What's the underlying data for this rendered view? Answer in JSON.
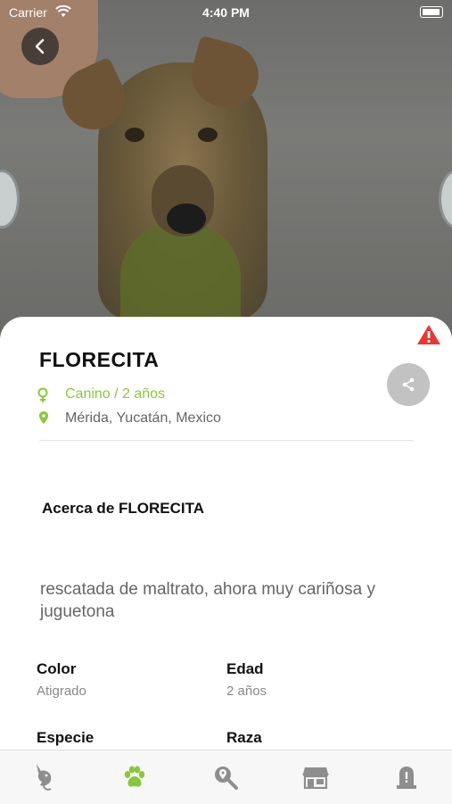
{
  "status_bar": {
    "carrier": "Carrier",
    "time": "4:40 PM"
  },
  "pet": {
    "name": "FLORECITA",
    "species_age": "Canino / 2 años",
    "location": "Mérida, Yucatán, Mexico",
    "about_title": "Acerca de FLORECITA",
    "description": "rescatada de maltrato, ahora muy cariñosa y juguetona"
  },
  "details": [
    {
      "label": "Color",
      "value": "Atigrado"
    },
    {
      "label": "Edad",
      "value": "2 años"
    },
    {
      "label": "Especie",
      "value": ""
    },
    {
      "label": "Raza",
      "value": ""
    }
  ],
  "colors": {
    "accent": "#8cc63f",
    "warning": "#e53935",
    "tab_active": "#8cc63f",
    "tab_inactive": "#8e8e8e"
  },
  "tabs": [
    {
      "icon": "bird-icon",
      "active": false
    },
    {
      "icon": "paw-icon",
      "active": true
    },
    {
      "icon": "search-location-icon",
      "active": false
    },
    {
      "icon": "store-icon",
      "active": false
    },
    {
      "icon": "memorial-icon",
      "active": false
    }
  ]
}
